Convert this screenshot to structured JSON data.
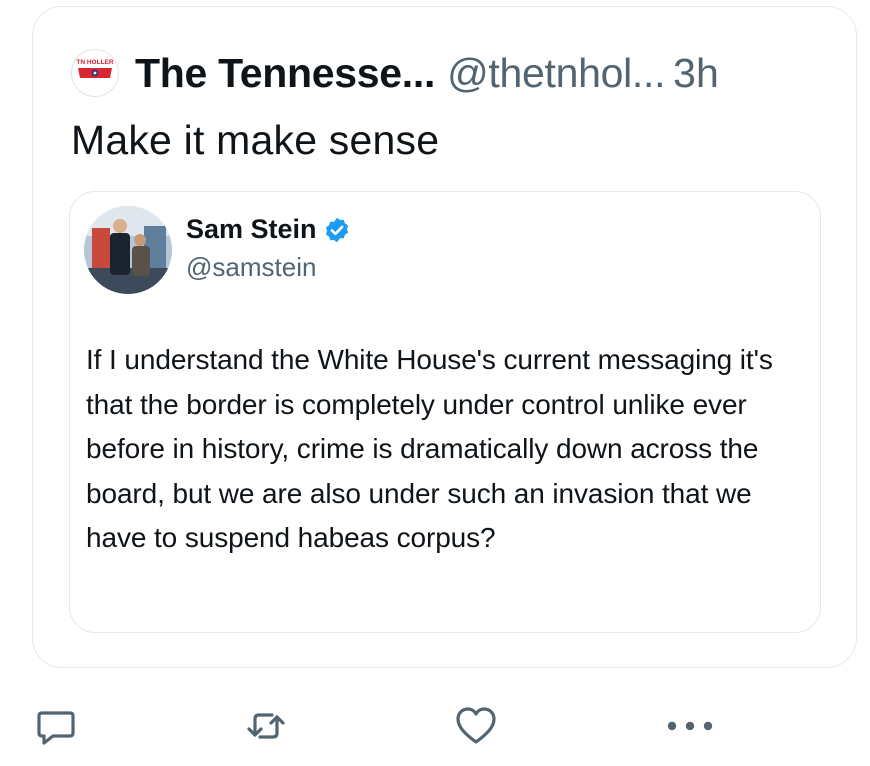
{
  "post": {
    "author_name": "The Tennesse...",
    "author_handle": "@thetnhol...",
    "time": "3h",
    "logo_text": "TN HOLLER",
    "text": "Make it make sense"
  },
  "quoted": {
    "name": "Sam Stein",
    "handle": "@samstein",
    "text": "If I understand the White House's current messaging it's that the border is completely under control unlike ever before in history, crime is dramatically down across the board, but we are also under such an invasion that we have to suspend habeas corpus?"
  },
  "actions": {
    "reply_icon": "reply-icon",
    "repost_icon": "repost-icon",
    "like_icon": "heart-icon",
    "more_icon": "more-icon"
  },
  "colors": {
    "text": "#0f1419",
    "secondary": "#536471",
    "border": "#e6e9ec",
    "verified": "#1d9bf0",
    "brand_red": "#d7262f",
    "icon": "#536471"
  }
}
